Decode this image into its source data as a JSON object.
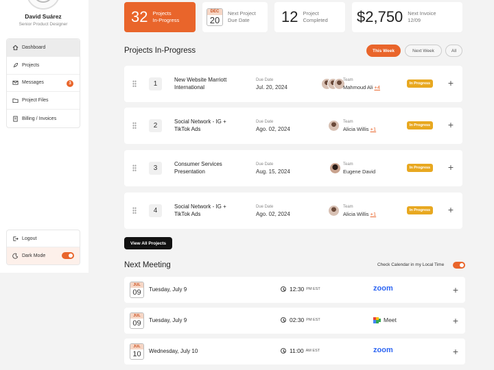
{
  "user": {
    "name": "David Suárez",
    "role": "Senior Product Designer"
  },
  "sidebar": {
    "items": [
      {
        "label": "Dashboard",
        "icon": "home-icon"
      },
      {
        "label": "Projects",
        "icon": "rocket-icon"
      },
      {
        "label": "Messages",
        "icon": "mail-icon",
        "badge": "3"
      },
      {
        "label": "Project Files",
        "icon": "folder-icon"
      },
      {
        "label": "Billing / Invoices",
        "icon": "invoice-icon"
      }
    ],
    "logout": "Logout",
    "dark_mode": "Dark Mode"
  },
  "stats": {
    "in_progress": {
      "value": "32",
      "label1": "Projects",
      "label2": "In-Progress"
    },
    "next_due": {
      "month": "DEC",
      "day": "20",
      "label1": "Next Project",
      "label2": "Due Date"
    },
    "completed": {
      "value": "12",
      "label1": "Project",
      "label2": "Completed"
    },
    "invoice": {
      "value": "$2,750",
      "label1": "Next Invoice",
      "label2": "12/09"
    }
  },
  "projects_section": {
    "title": "Projects In-Progress",
    "filters": [
      "This Week",
      "Next Week",
      "All"
    ],
    "due_label": "Due Date",
    "team_label": "Team",
    "rows": [
      {
        "num": "1",
        "name": "New Website Marriott International",
        "due": "Jul. 20, 2024",
        "team": "Mahmoud Ali",
        "more": "+4",
        "status": "In Progress"
      },
      {
        "num": "2",
        "name": "Social Network - IG + TikTok Ads",
        "due": "Ago. 02, 2024",
        "team": "Alicia Willis",
        "more": "+1",
        "status": "In Progress"
      },
      {
        "num": "3",
        "name": "Consumer Services Presentation",
        "due": "Aug. 15, 2024",
        "team": "Eugene David",
        "more": "",
        "status": "In Progress"
      },
      {
        "num": "4",
        "name": "Social Network - IG + TikTok Ads",
        "due": "Ago. 02, 2024",
        "team": "Alicia Willis",
        "more": "+1",
        "status": "In Progress"
      }
    ],
    "view_all": "View All Projects"
  },
  "meetings": {
    "title": "Next Meeting",
    "calendar_check": "Check Calendar in my Local Time",
    "rows": [
      {
        "month": "JUL",
        "day": "09",
        "date": "Tuesday, July 9",
        "time": "12:30",
        "tz": "PM EST",
        "platform": "zoom"
      },
      {
        "month": "JUL",
        "day": "09",
        "date": "Tuesday, July 9",
        "time": "02:30",
        "tz": "PM EST",
        "platform": "Meet"
      },
      {
        "month": "JUL",
        "day": "10",
        "date": "Wednesday, July 10",
        "time": "11:00",
        "tz": "AM EST",
        "platform": "zoom"
      }
    ]
  },
  "colors": {
    "accent": "#e9652b",
    "status": "#e8a820",
    "zoom": "#2d65f2"
  }
}
